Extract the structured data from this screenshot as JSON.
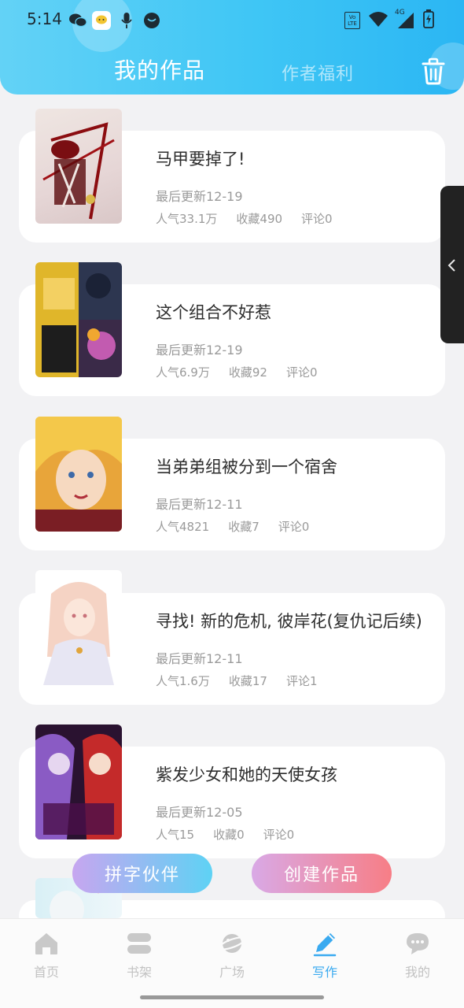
{
  "status_bar": {
    "time": "5:14",
    "left_icons": [
      "wechat-icon",
      "chat-bubble-app-icon",
      "microphone-icon",
      "app-circle-icon"
    ],
    "right_icons": [
      "volte-icon",
      "wifi-icon",
      "signal-4g-icon",
      "battery-charging-icon"
    ],
    "network": "4G",
    "volte": "VoLTE"
  },
  "header": {
    "tabs": [
      {
        "label": "我的作品",
        "active": true
      },
      {
        "label": "作者福利",
        "active": false
      }
    ],
    "trash_icon": "trash-icon",
    "accent_color": "#3fc6f5"
  },
  "works": [
    {
      "title": "马甲要掉了!",
      "updated": "最后更新12-19",
      "popularity": "人气33.1万",
      "favorites": "收藏490",
      "comments": "评论0"
    },
    {
      "title": "这个组合不好惹",
      "updated": "最后更新12-19",
      "popularity": "人气6.9万",
      "favorites": "收藏92",
      "comments": "评论0"
    },
    {
      "title": "当弟弟组被分到一个宿舍",
      "updated": "最后更新12-11",
      "popularity": "人气4821",
      "favorites": "收藏7",
      "comments": "评论0"
    },
    {
      "title": "寻找! 新的危机, 彼岸花(复仇记后续)",
      "updated": "最后更新12-11",
      "popularity": "人气1.6万",
      "favorites": "收藏17",
      "comments": "评论1"
    },
    {
      "title": "紫发少女和她的天使女孩",
      "updated": "最后更新12-05",
      "popularity": "人气15",
      "favorites": "收藏0",
      "comments": "评论0"
    }
  ],
  "floating_buttons": {
    "partner": "拼字伙伴",
    "create": "创建作品"
  },
  "side_handle_icon": "chevron-left-icon",
  "bottom_nav": [
    {
      "label": "首页",
      "icon": "home-icon",
      "active": false
    },
    {
      "label": "书架",
      "icon": "bookshelf-icon",
      "active": false
    },
    {
      "label": "广场",
      "icon": "planet-icon",
      "active": false
    },
    {
      "label": "写作",
      "icon": "pen-icon",
      "active": true
    },
    {
      "label": "我的",
      "icon": "profile-chat-icon",
      "active": false
    }
  ]
}
